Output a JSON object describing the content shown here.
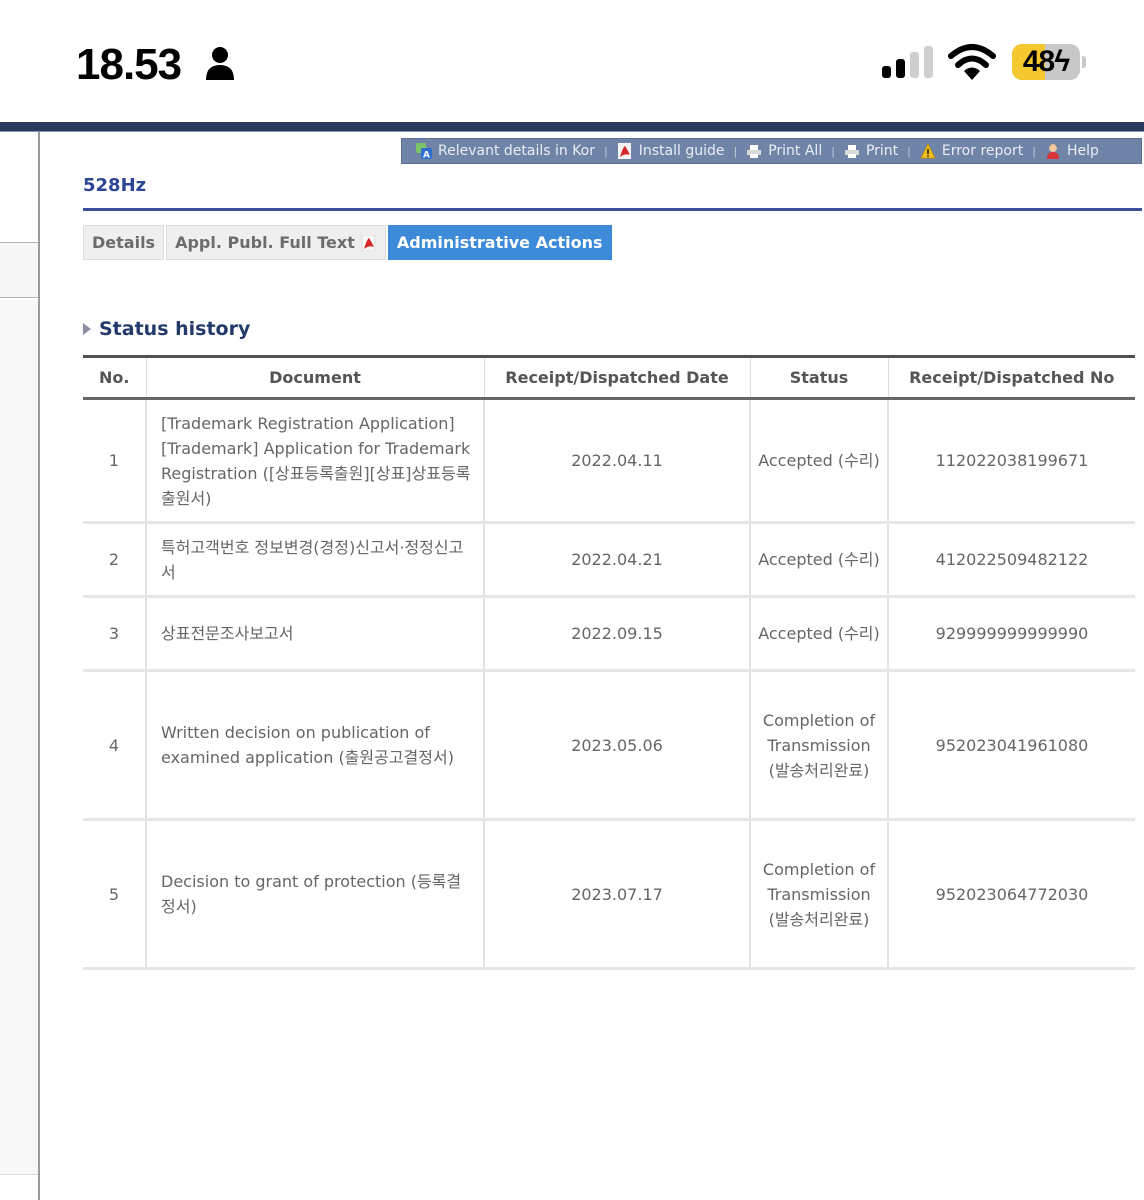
{
  "status_bar": {
    "time": "18.53",
    "battery_percent": 48,
    "battery_label": "48",
    "charging": true,
    "signal_bars_active": 2,
    "signal_bars_total": 4
  },
  "toolbar": {
    "items": [
      {
        "label": "Relevant details in Kor",
        "icon": "translate-icon"
      },
      {
        "label": "Install guide",
        "icon": "pdf-icon"
      },
      {
        "label": "Print All",
        "icon": "printer-icon"
      },
      {
        "label": "Print",
        "icon": "printer-icon"
      },
      {
        "label": "Error report",
        "icon": "warning-icon"
      },
      {
        "label": "Help",
        "icon": "help-person-icon"
      }
    ],
    "background": "#6f84a6"
  },
  "page": {
    "title": "528Hz",
    "title_color": "#2e4494"
  },
  "tabs": [
    {
      "label": "Details",
      "active": false
    },
    {
      "label": "Appl. Publ. Full Text",
      "active": false,
      "icon": "pdf-icon"
    },
    {
      "label": "Administrative Actions",
      "active": true
    }
  ],
  "accent_color": "#3d8ad8",
  "section": {
    "title": "Status history"
  },
  "table": {
    "columns": [
      "No.",
      "Document",
      "Receipt/Dispatched Date",
      "Status",
      "Receipt/Dispatched No"
    ],
    "rows": [
      {
        "no": "1",
        "document": "[Trademark Registration Application][Trademark] Application for Trademark Registration ([상표등록출원][상표]상표등록출원서)",
        "date": "2022.04.11",
        "status": "Accepted (수리)",
        "number": "112022038199671"
      },
      {
        "no": "2",
        "document": "특허고객번호 정보변경(경정)신고서·정정신고서",
        "date": "2022.04.21",
        "status": "Accepted (수리)",
        "number": "412022509482122"
      },
      {
        "no": "3",
        "document": "상표전문조사보고서",
        "date": "2022.09.15",
        "status": "Accepted (수리)",
        "number": "929999999999990"
      },
      {
        "no": "4",
        "document": "Written decision on publication of examined application (출원공고결정서)",
        "date": "2023.05.06",
        "status": "Completion of Transmission (발송처리완료)",
        "number": "952023041961080"
      },
      {
        "no": "5",
        "document": "Decision to grant of protection (등록결정서)",
        "date": "2023.07.17",
        "status": "Completion of Transmission (발송처리완료)",
        "number": "952023064772030"
      }
    ]
  }
}
